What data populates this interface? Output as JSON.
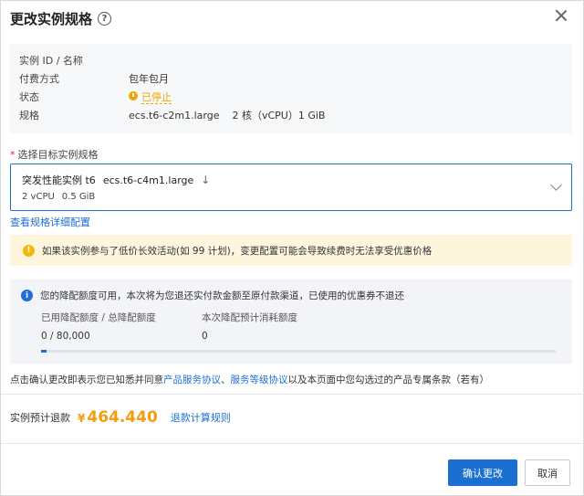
{
  "dialog": {
    "title": "更改实例规格",
    "help_icon": "?"
  },
  "instance_info": {
    "rows": [
      {
        "label": "实例 ID / 名称",
        "value": ""
      },
      {
        "label": "付费方式",
        "value": "包年包月"
      },
      {
        "label": "状态",
        "value": "已停止"
      },
      {
        "label": "规格",
        "value": "ecs.t6-c2m1.large",
        "extra": "2 核（vCPU）1 GiB"
      }
    ]
  },
  "spec_select": {
    "required_mark": "*",
    "label": "选择目标实例规格",
    "family": "突发性能实例 t6",
    "spec": "ecs.t6-c4m1.large",
    "arrow": "↓",
    "vcpu": "2 vCPU",
    "memory": "0.5 GiB"
  },
  "links": {
    "view_spec_details": "查看规格详细配置",
    "product_agreement": "产品服务协议",
    "sla_agreement": "服务等级协议",
    "refund_rules": "退款计算规则"
  },
  "warning": {
    "icon": "!",
    "text": "如果该实例参与了低价长效活动(如 99 计划)，变更配置可能会导致续费时无法享受优惠价格"
  },
  "quota": {
    "icon": "i",
    "message": "您的降配额度可用，本次将为您退还实付款金额至原付款渠道，已使用的优惠券不退还",
    "used_label": "已用降配额度 / 总降配额度",
    "used_info_icon": "?",
    "used_value": "0 / 80,000",
    "estimate_label": "本次降配预计消耗额度",
    "estimate_value": "0",
    "progress_fraction": 0.0
  },
  "agreement": {
    "prefix": "点击确认更改即表示您已知悉并同意",
    "sep": "、",
    "suffix": "以及本页面中您勾选过的产品专属条款（若有）"
  },
  "refund": {
    "label": "实例预计退款",
    "currency": "¥",
    "amount": "464.440"
  },
  "buttons": {
    "confirm": "确认更改",
    "cancel": "取消"
  },
  "colors": {
    "primary": "#1a6fd1",
    "warning": "#f39c12",
    "status": "#f0a500"
  }
}
